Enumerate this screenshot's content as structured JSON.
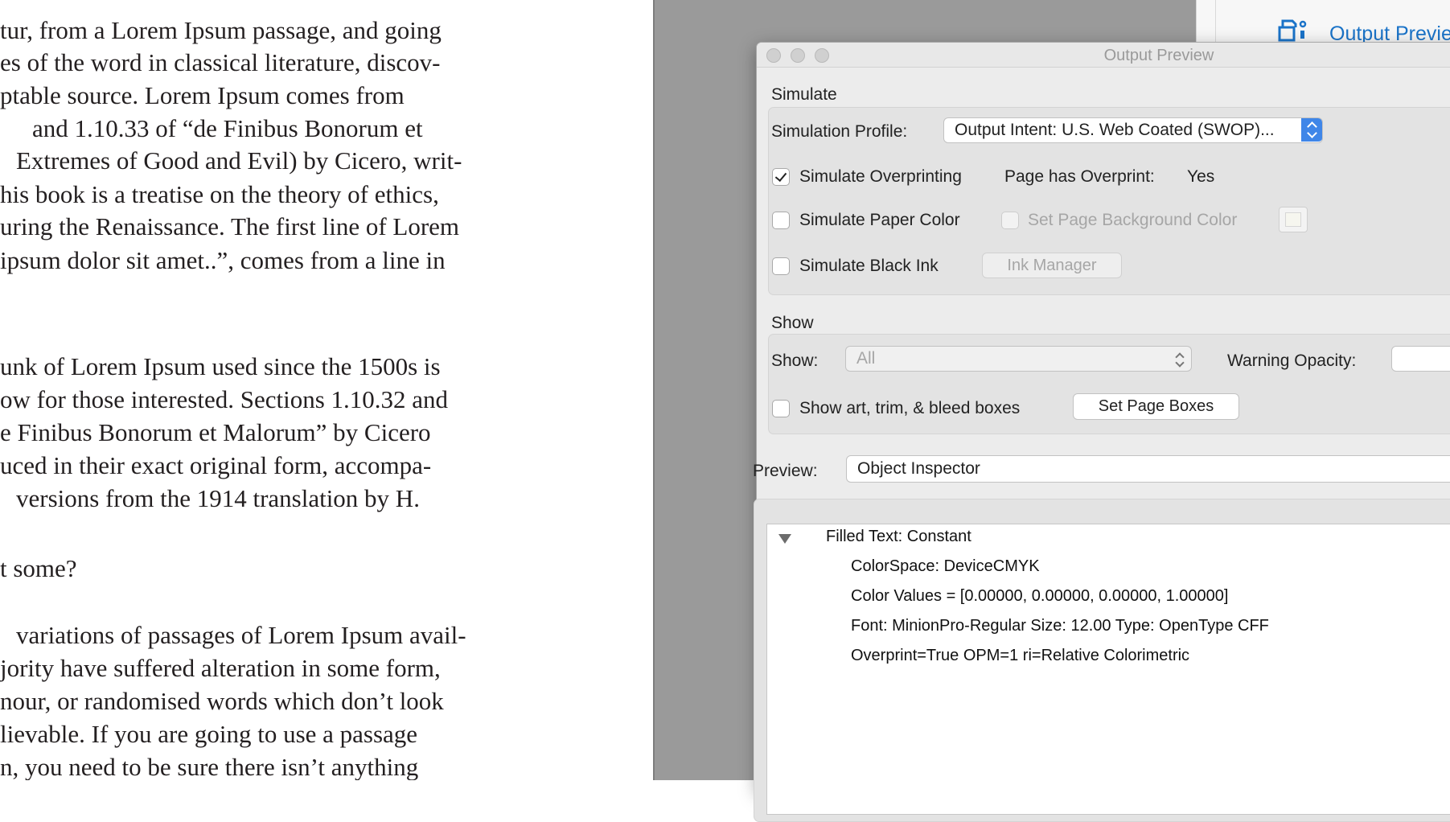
{
  "document": {
    "lines": [
      "tur, from a Lorem Ipsum passage, and going",
      "es of the word in classical literature, discov-",
      "ptable source. Lorem Ipsum comes from",
      "and 1.10.33 of “de Finibus Bonorum et",
      "Extremes of Good and Evil) by Cicero, writ-",
      "his book is a treatise on the theory of ethics,",
      "uring the Renaissance. The first line of Lorem",
      "ipsum dolor sit amet..”, comes from a line in",
      "unk of Lorem Ipsum used since the 1500s is",
      "ow for those interested. Sections 1.10.32 and",
      "e Finibus Bonorum et Malorum” by Cicero",
      "uced in their exact original form, accompa-",
      "versions from the 1914 translation by H.",
      "t some?",
      "variations of passages of Lorem Ipsum avail-",
      "jority have suffered alteration in some form,",
      "nour, or randomised words which don’t look",
      "lievable. If you are going to use a passage",
      "n, you need to be sure there isn’t anything"
    ]
  },
  "tool_panel": {
    "icon": "output-preview-tool-icon",
    "label": "Output Previe"
  },
  "dialog": {
    "title": "Output Preview",
    "simulate": {
      "heading": "Simulate",
      "profile_label": "Simulation Profile:",
      "profile_value": "Output Intent: U.S. Web Coated (SWOP)...",
      "simulate_overprinting_label": "Simulate Overprinting",
      "simulate_overprinting_checked": true,
      "page_has_overprint_label": "Page has Overprint:",
      "page_has_overprint_value": "Yes",
      "simulate_paper_color_label": "Simulate Paper Color",
      "simulate_paper_color_checked": false,
      "set_page_bg_label": "Set Page Background Color",
      "set_page_bg_checked": false,
      "simulate_black_ink_label": "Simulate Black Ink",
      "simulate_black_ink_checked": false,
      "ink_manager_label": "Ink Manager"
    },
    "show": {
      "heading": "Show",
      "show_label": "Show:",
      "show_value": "All",
      "warning_opacity_label": "Warning Opacity:",
      "show_boxes_label": "Show art, trim, & bleed boxes",
      "show_boxes_checked": false,
      "set_page_boxes_label": "Set Page Boxes"
    },
    "preview": {
      "label": "Preview:",
      "value": "Object Inspector"
    },
    "inspector": {
      "root": "Filled Text: Constant",
      "colorspace": "ColorSpace: DeviceCMYK",
      "color_values": "Color Values = [0.00000, 0.00000, 0.00000, 1.00000]",
      "font": "Font: MinionPro-Regular Size: 12.00 Type: OpenType CFF",
      "overprint": "Overprint=True OPM=1 ri=Relative Colorimetric"
    }
  },
  "colors": {
    "accent": "#3f86e8",
    "link": "#1a73c8",
    "viewer_gray": "#9a9a9a",
    "dialog_bg": "#ececec"
  }
}
